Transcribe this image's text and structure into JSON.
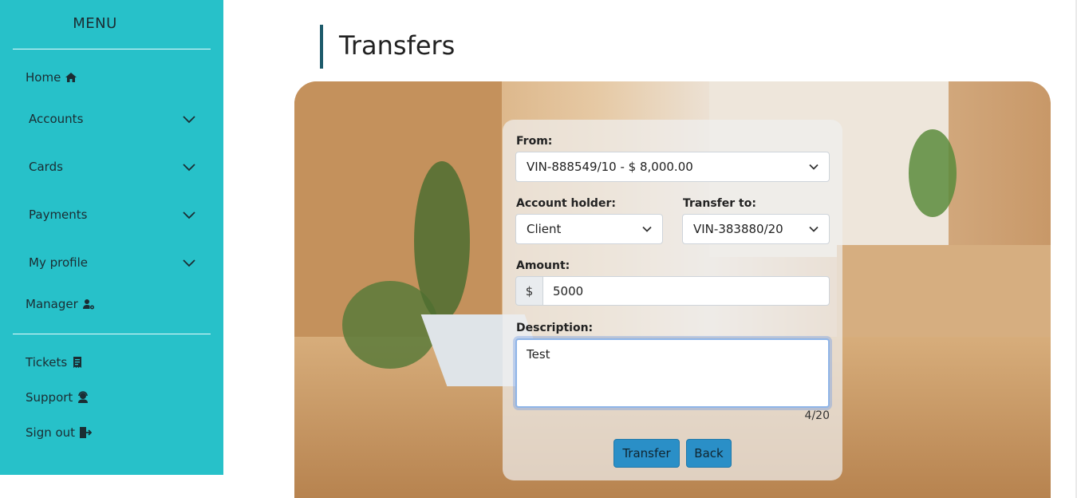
{
  "sidebar": {
    "menu_title": "MENU",
    "items": [
      {
        "label": "Home",
        "icon": "home-icon"
      },
      {
        "label": "Accounts",
        "icon": "chevron-down-icon"
      },
      {
        "label": "Cards",
        "icon": "chevron-down-icon"
      },
      {
        "label": "Payments",
        "icon": "chevron-down-icon"
      },
      {
        "label": "My profile",
        "icon": "chevron-down-icon"
      },
      {
        "label": "Manager",
        "icon": "user-gear-icon"
      },
      {
        "label": "Tickets",
        "icon": "receipt-icon"
      },
      {
        "label": "Support",
        "icon": "headset-icon"
      },
      {
        "label": "Sign out",
        "icon": "sign-out-icon"
      }
    ]
  },
  "page": {
    "title": "Transfers"
  },
  "form": {
    "from_label": "From:",
    "from_value": "VIN-888549/10 - $ 8,000.00",
    "holder_label": "Account holder:",
    "holder_value": "Client",
    "transfer_to_label": "Transfer to:",
    "transfer_to_value": "VIN-383880/20",
    "amount_label": "Amount:",
    "currency_symbol": "$",
    "amount_value": "5000",
    "description_label": "Description:",
    "description_value": "Test",
    "char_counter": "4/20",
    "transfer_button": "Transfer",
    "back_button": "Back"
  },
  "colors": {
    "sidebar_bg": "#27c1c9",
    "title_accent": "#1e5b6b",
    "button_bg": "#2a8fc7"
  }
}
